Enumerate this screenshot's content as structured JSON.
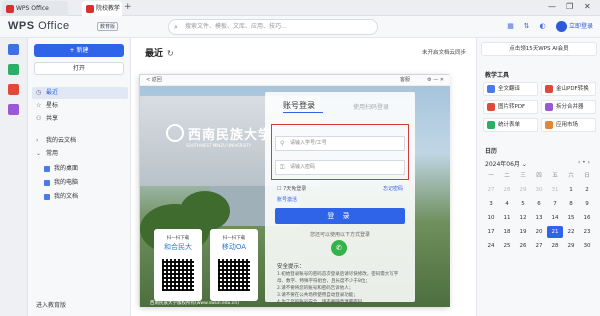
{
  "titlebar": {
    "tabs": [
      {
        "label": "WPS Office"
      },
      {
        "label": "院校教学辅助"
      }
    ],
    "new_tab": "+",
    "window_controls": [
      "—",
      "❐",
      "✕"
    ]
  },
  "toolbar": {
    "logo_left": "WPS",
    "logo_right": "Office",
    "edition_badge": "教育版",
    "search_placeholder": "搜索文件、模板、文库、应用、技巧...",
    "login_label": "立即登录"
  },
  "sidebar": {
    "new_button": "+ 新建",
    "open_button": "打开",
    "nav": [
      {
        "label": "最近",
        "icon": "clock-icon",
        "active": true
      },
      {
        "label": "星标",
        "icon": "star-icon"
      },
      {
        "label": "共享",
        "icon": "share-icon"
      },
      {
        "label": "我的云文档",
        "icon": "cloud-icon"
      },
      {
        "label": "常用",
        "icon": "star-icon"
      }
    ],
    "sub_items": [
      {
        "label": "我的桌面"
      },
      {
        "label": "我的电脑"
      },
      {
        "label": "我的文档"
      }
    ],
    "bottom_link": "进入教育版"
  },
  "main": {
    "heading": "最近",
    "sync_note": "未开启文档云同步"
  },
  "dialog": {
    "back_label": "< 返回",
    "help_label": "客服",
    "university_name": "西南民族大学",
    "university_en": "SOUTHWEST MINZU UNIVERSITY",
    "qr_cards": [
      {
        "title": "扫一扫下载",
        "name": "和合民大"
      },
      {
        "title": "扫一扫下载",
        "name": "移动OA"
      }
    ],
    "footer": "西南民族大学版权所有(www.swun.edu.cn)",
    "login": {
      "tab_account": "账号登录",
      "tab_qr": "使用扫码登录",
      "username_placeholder": "请输入学号/工号",
      "password_placeholder": "请输入密码",
      "remember": "7天免登录",
      "forgot": "忘记密码",
      "signup": "账号激活",
      "submit": "登 录",
      "other_login": "您还可以使用以下方式登录",
      "tips_heading": "安全提示：",
      "tips": [
        "1.初始登录账号的密码首次登录后请尽快修改，密码需大写字母、数字、特殊字符组合，且长度不少于8位；",
        "2.请不要将您的账号和密码告诉他人；",
        "3.请不要在公共场所使用自动登录功能；",
        "4.为了您的账号安全，请不要随意泄露密码"
      ]
    }
  },
  "rightpanel": {
    "ai_banner": "点击领15天WPS AI会员",
    "tools_heading": "教学工具",
    "tools": [
      {
        "label": "全文翻译",
        "color": "#4a7be8"
      },
      {
        "label": "金山PDF转换",
        "color": "#e0493a"
      },
      {
        "label": "图片转PDF",
        "color": "#e0493a"
      },
      {
        "label": "拆分合并器",
        "color": "#9a57d6"
      },
      {
        "label": "统计表单",
        "color": "#2cae66"
      },
      {
        "label": "应用市场",
        "color": "#e0863a"
      }
    ],
    "calendar_heading": "日历",
    "calendar_month": "2024年06月",
    "calendar_dow": [
      "一",
      "二",
      "三",
      "四",
      "五",
      "六",
      "日"
    ],
    "calendar_days": [
      "27",
      "28",
      "29",
      "30",
      "31",
      "1",
      "2",
      "3",
      "4",
      "5",
      "6",
      "7",
      "8",
      "9",
      "10",
      "11",
      "12",
      "13",
      "14",
      "15",
      "16",
      "17",
      "18",
      "19",
      "20",
      "21",
      "22",
      "23",
      "24",
      "25",
      "26",
      "27",
      "28",
      "29",
      "30"
    ],
    "calendar_today": "21"
  }
}
